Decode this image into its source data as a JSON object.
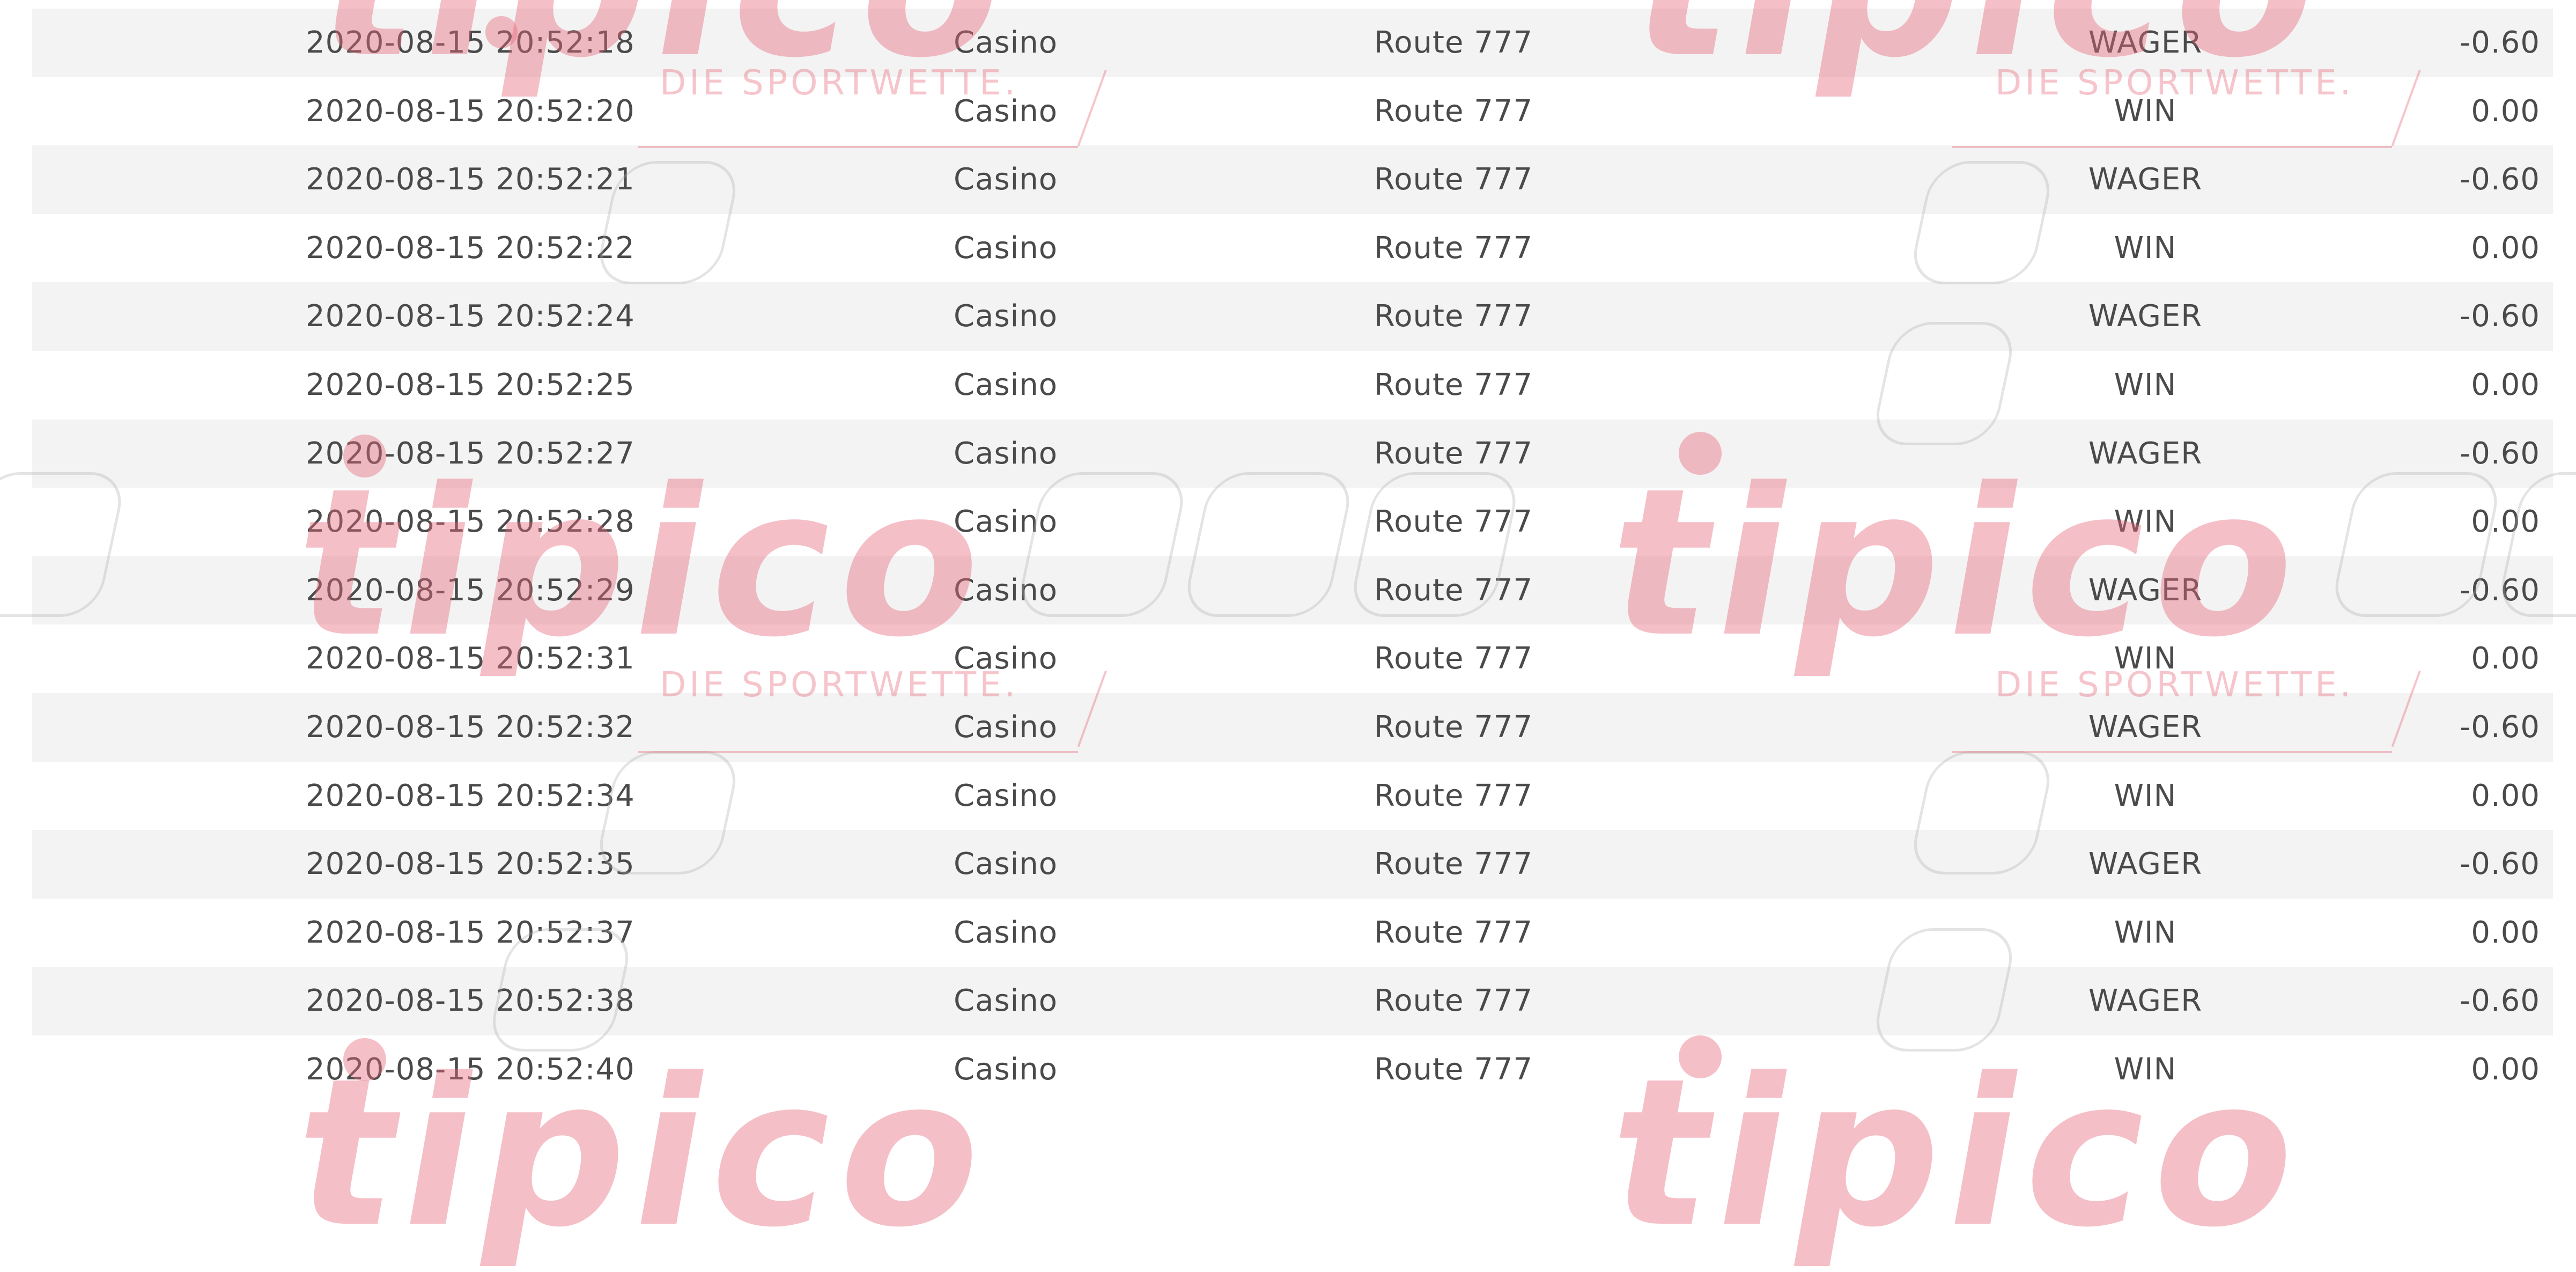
{
  "watermark": {
    "brand": "tipico",
    "tagline": "DIE SPORTWETTE.",
    "color": "#e8677a"
  },
  "transactions": [
    {
      "datetime": "2020-08-15 20:52:18",
      "category": "Casino",
      "game": "Route 777",
      "type": "WAGER",
      "amount": "-0.60"
    },
    {
      "datetime": "2020-08-15 20:52:20",
      "category": "Casino",
      "game": "Route 777",
      "type": "WIN",
      "amount": "0.00"
    },
    {
      "datetime": "2020-08-15 20:52:21",
      "category": "Casino",
      "game": "Route 777",
      "type": "WAGER",
      "amount": "-0.60"
    },
    {
      "datetime": "2020-08-15 20:52:22",
      "category": "Casino",
      "game": "Route 777",
      "type": "WIN",
      "amount": "0.00"
    },
    {
      "datetime": "2020-08-15 20:52:24",
      "category": "Casino",
      "game": "Route 777",
      "type": "WAGER",
      "amount": "-0.60"
    },
    {
      "datetime": "2020-08-15 20:52:25",
      "category": "Casino",
      "game": "Route 777",
      "type": "WIN",
      "amount": "0.00"
    },
    {
      "datetime": "2020-08-15 20:52:27",
      "category": "Casino",
      "game": "Route 777",
      "type": "WAGER",
      "amount": "-0.60"
    },
    {
      "datetime": "2020-08-15 20:52:28",
      "category": "Casino",
      "game": "Route 777",
      "type": "WIN",
      "amount": "0.00"
    },
    {
      "datetime": "2020-08-15 20:52:29",
      "category": "Casino",
      "game": "Route 777",
      "type": "WAGER",
      "amount": "-0.60"
    },
    {
      "datetime": "2020-08-15 20:52:31",
      "category": "Casino",
      "game": "Route 777",
      "type": "WIN",
      "amount": "0.00"
    },
    {
      "datetime": "2020-08-15 20:52:32",
      "category": "Casino",
      "game": "Route 777",
      "type": "WAGER",
      "amount": "-0.60"
    },
    {
      "datetime": "2020-08-15 20:52:34",
      "category": "Casino",
      "game": "Route 777",
      "type": "WIN",
      "amount": "0.00"
    },
    {
      "datetime": "2020-08-15 20:52:35",
      "category": "Casino",
      "game": "Route 777",
      "type": "WAGER",
      "amount": "-0.60"
    },
    {
      "datetime": "2020-08-15 20:52:37",
      "category": "Casino",
      "game": "Route 777",
      "type": "WIN",
      "amount": "0.00"
    },
    {
      "datetime": "2020-08-15 20:52:38",
      "category": "Casino",
      "game": "Route 777",
      "type": "WAGER",
      "amount": "-0.60"
    },
    {
      "datetime": "2020-08-15 20:52:40",
      "category": "Casino",
      "game": "Route 777",
      "type": "WIN",
      "amount": "0.00"
    }
  ]
}
